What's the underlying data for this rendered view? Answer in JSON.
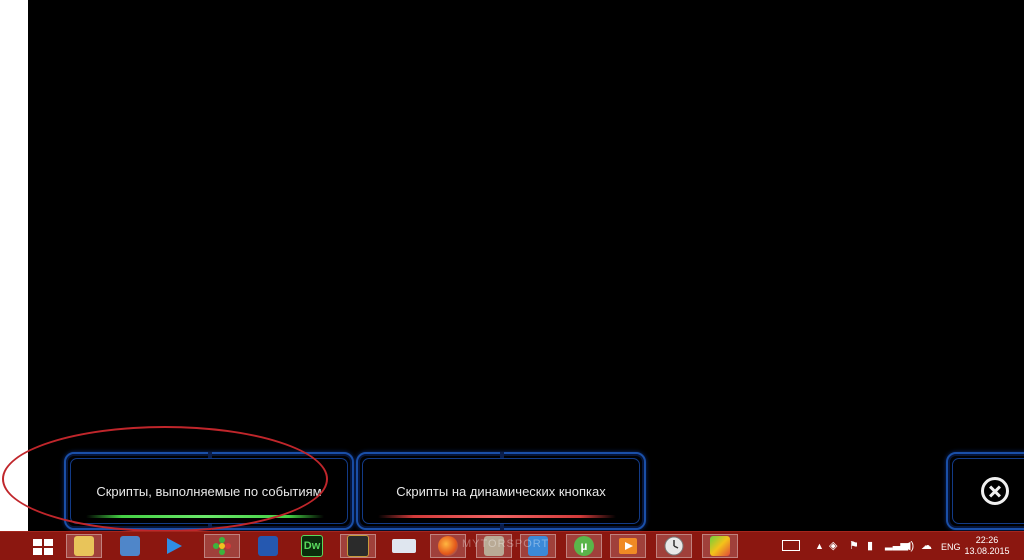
{
  "app": {
    "event_scripts_label": "Скрипты, выполняемые по событиям",
    "dynamic_button_scripts_label": "Скрипты на динамических кнопках",
    "colors": {
      "panel_border": "#1a4fa8",
      "event_bar": "#44d044",
      "dynamic_bar": "#d23a3a",
      "annotation": "#c0262b"
    }
  },
  "taskbar": {
    "watermark": "MYTORSPORT",
    "apps": [
      {
        "name": "file-explorer-icon"
      },
      {
        "name": "calculator-icon"
      },
      {
        "name": "media-player-icon"
      },
      {
        "name": "icq-icon"
      },
      {
        "name": "save-disk-icon"
      },
      {
        "name": "dreamweaver-icon",
        "label": "Dw"
      },
      {
        "name": "window-app-icon"
      },
      {
        "name": "on-screen-keyboard-icon"
      },
      {
        "name": "firefox-icon"
      },
      {
        "name": "home-app-icon"
      },
      {
        "name": "remote-desktop-icon"
      },
      {
        "name": "utorrent-icon"
      },
      {
        "name": "video-player-icon"
      },
      {
        "name": "clock-app-icon"
      },
      {
        "name": "bluestacks-icon"
      }
    ],
    "tray": {
      "language": "ENG",
      "time": "22:26",
      "date": "13.08.2015"
    }
  }
}
